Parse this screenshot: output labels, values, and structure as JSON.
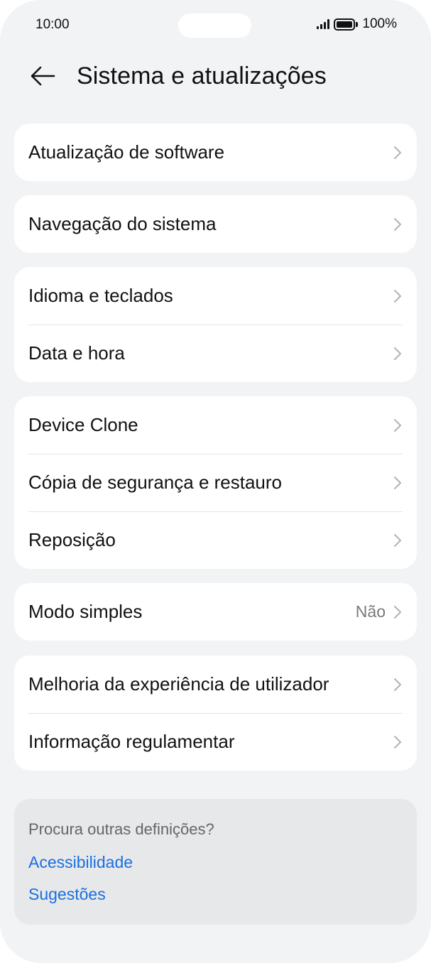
{
  "status_bar": {
    "time": "10:00",
    "battery": "100%"
  },
  "header": {
    "title": "Sistema e atualizações"
  },
  "groups": [
    {
      "items": [
        {
          "label": "Atualização de software"
        }
      ]
    },
    {
      "items": [
        {
          "label": "Navegação do sistema"
        }
      ]
    },
    {
      "items": [
        {
          "label": "Idioma e teclados"
        },
        {
          "label": "Data e hora"
        }
      ]
    },
    {
      "items": [
        {
          "label": "Device Clone"
        },
        {
          "label": "Cópia de segurança e restauro"
        },
        {
          "label": "Reposição"
        }
      ]
    },
    {
      "items": [
        {
          "label": "Modo simples",
          "value": "Não"
        }
      ]
    },
    {
      "items": [
        {
          "label": "Melhoria da experiência de utilizador"
        },
        {
          "label": "Informação regulamentar"
        }
      ]
    }
  ],
  "suggestions": {
    "title": "Procura outras definições?",
    "links": [
      "Acessibilidade",
      "Sugestões"
    ]
  },
  "colors": {
    "background": "#f1f3f5",
    "card": "#ffffff",
    "link": "#1a6fe0"
  }
}
